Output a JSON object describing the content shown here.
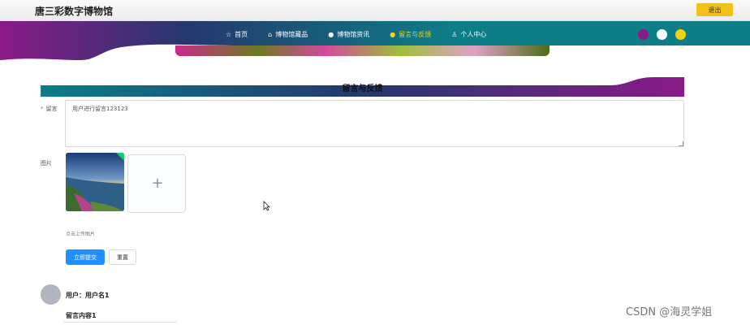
{
  "header": {
    "site_title": "唐三彩数字博物馆",
    "logout_label": "退出"
  },
  "nav": {
    "items": [
      {
        "icon": "star-icon",
        "glyph": "☆",
        "label": "首页",
        "active": false
      },
      {
        "icon": "box-icon",
        "glyph": "⌂",
        "label": "博物馆藏品",
        "active": false
      },
      {
        "icon": "dot-icon",
        "glyph": "●",
        "label": "博物馆资讯",
        "active": false
      },
      {
        "icon": "dot-icon",
        "glyph": "●",
        "label": "留言与反馈",
        "active": true
      },
      {
        "icon": "user-icon",
        "glyph": "♙",
        "label": "个人中心",
        "active": false
      }
    ],
    "theme_colors": [
      "#8a1a87",
      "#ffffff",
      "#f5d20f"
    ]
  },
  "section": {
    "title": "留言与反馈"
  },
  "form": {
    "message_label": "留言",
    "message_required_mark": "*",
    "message_value": "用户进行留言123123",
    "image_label": "图片",
    "upload_plus": "+",
    "upload_hint": "点击上传图片",
    "submit_label": "立即提交",
    "reset_label": "重置"
  },
  "comments": [
    {
      "user_line": "用户：用户名1",
      "content_line": "留言内容1"
    }
  ],
  "watermark": "CSDN @海灵学姐",
  "colors": {
    "gradient_purple": "#8a1a87",
    "gradient_navy": "#24386e",
    "gradient_teal": "#0d7d86",
    "accent_yellow": "#f2c21b",
    "primary_blue": "#1e90ff"
  }
}
